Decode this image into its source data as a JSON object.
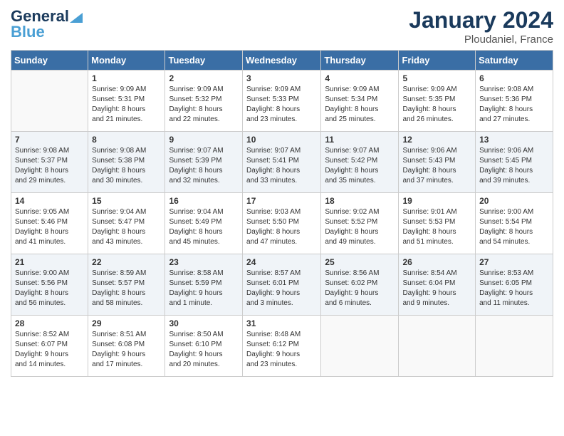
{
  "header": {
    "logo_general": "General",
    "logo_blue": "Blue",
    "month": "January 2024",
    "location": "Ploudaniel, France"
  },
  "days_of_week": [
    "Sunday",
    "Monday",
    "Tuesday",
    "Wednesday",
    "Thursday",
    "Friday",
    "Saturday"
  ],
  "weeks": [
    [
      {
        "day": "",
        "info": ""
      },
      {
        "day": "1",
        "info": "Sunrise: 9:09 AM\nSunset: 5:31 PM\nDaylight: 8 hours\nand 21 minutes."
      },
      {
        "day": "2",
        "info": "Sunrise: 9:09 AM\nSunset: 5:32 PM\nDaylight: 8 hours\nand 22 minutes."
      },
      {
        "day": "3",
        "info": "Sunrise: 9:09 AM\nSunset: 5:33 PM\nDaylight: 8 hours\nand 23 minutes."
      },
      {
        "day": "4",
        "info": "Sunrise: 9:09 AM\nSunset: 5:34 PM\nDaylight: 8 hours\nand 25 minutes."
      },
      {
        "day": "5",
        "info": "Sunrise: 9:09 AM\nSunset: 5:35 PM\nDaylight: 8 hours\nand 26 minutes."
      },
      {
        "day": "6",
        "info": "Sunrise: 9:08 AM\nSunset: 5:36 PM\nDaylight: 8 hours\nand 27 minutes."
      }
    ],
    [
      {
        "day": "7",
        "info": "Sunrise: 9:08 AM\nSunset: 5:37 PM\nDaylight: 8 hours\nand 29 minutes."
      },
      {
        "day": "8",
        "info": "Sunrise: 9:08 AM\nSunset: 5:38 PM\nDaylight: 8 hours\nand 30 minutes."
      },
      {
        "day": "9",
        "info": "Sunrise: 9:07 AM\nSunset: 5:39 PM\nDaylight: 8 hours\nand 32 minutes."
      },
      {
        "day": "10",
        "info": "Sunrise: 9:07 AM\nSunset: 5:41 PM\nDaylight: 8 hours\nand 33 minutes."
      },
      {
        "day": "11",
        "info": "Sunrise: 9:07 AM\nSunset: 5:42 PM\nDaylight: 8 hours\nand 35 minutes."
      },
      {
        "day": "12",
        "info": "Sunrise: 9:06 AM\nSunset: 5:43 PM\nDaylight: 8 hours\nand 37 minutes."
      },
      {
        "day": "13",
        "info": "Sunrise: 9:06 AM\nSunset: 5:45 PM\nDaylight: 8 hours\nand 39 minutes."
      }
    ],
    [
      {
        "day": "14",
        "info": "Sunrise: 9:05 AM\nSunset: 5:46 PM\nDaylight: 8 hours\nand 41 minutes."
      },
      {
        "day": "15",
        "info": "Sunrise: 9:04 AM\nSunset: 5:47 PM\nDaylight: 8 hours\nand 43 minutes."
      },
      {
        "day": "16",
        "info": "Sunrise: 9:04 AM\nSunset: 5:49 PM\nDaylight: 8 hours\nand 45 minutes."
      },
      {
        "day": "17",
        "info": "Sunrise: 9:03 AM\nSunset: 5:50 PM\nDaylight: 8 hours\nand 47 minutes."
      },
      {
        "day": "18",
        "info": "Sunrise: 9:02 AM\nSunset: 5:52 PM\nDaylight: 8 hours\nand 49 minutes."
      },
      {
        "day": "19",
        "info": "Sunrise: 9:01 AM\nSunset: 5:53 PM\nDaylight: 8 hours\nand 51 minutes."
      },
      {
        "day": "20",
        "info": "Sunrise: 9:00 AM\nSunset: 5:54 PM\nDaylight: 8 hours\nand 54 minutes."
      }
    ],
    [
      {
        "day": "21",
        "info": "Sunrise: 9:00 AM\nSunset: 5:56 PM\nDaylight: 8 hours\nand 56 minutes."
      },
      {
        "day": "22",
        "info": "Sunrise: 8:59 AM\nSunset: 5:57 PM\nDaylight: 8 hours\nand 58 minutes."
      },
      {
        "day": "23",
        "info": "Sunrise: 8:58 AM\nSunset: 5:59 PM\nDaylight: 9 hours\nand 1 minute."
      },
      {
        "day": "24",
        "info": "Sunrise: 8:57 AM\nSunset: 6:01 PM\nDaylight: 9 hours\nand 3 minutes."
      },
      {
        "day": "25",
        "info": "Sunrise: 8:56 AM\nSunset: 6:02 PM\nDaylight: 9 hours\nand 6 minutes."
      },
      {
        "day": "26",
        "info": "Sunrise: 8:54 AM\nSunset: 6:04 PM\nDaylight: 9 hours\nand 9 minutes."
      },
      {
        "day": "27",
        "info": "Sunrise: 8:53 AM\nSunset: 6:05 PM\nDaylight: 9 hours\nand 11 minutes."
      }
    ],
    [
      {
        "day": "28",
        "info": "Sunrise: 8:52 AM\nSunset: 6:07 PM\nDaylight: 9 hours\nand 14 minutes."
      },
      {
        "day": "29",
        "info": "Sunrise: 8:51 AM\nSunset: 6:08 PM\nDaylight: 9 hours\nand 17 minutes."
      },
      {
        "day": "30",
        "info": "Sunrise: 8:50 AM\nSunset: 6:10 PM\nDaylight: 9 hours\nand 20 minutes."
      },
      {
        "day": "31",
        "info": "Sunrise: 8:48 AM\nSunset: 6:12 PM\nDaylight: 9 hours\nand 23 minutes."
      },
      {
        "day": "",
        "info": ""
      },
      {
        "day": "",
        "info": ""
      },
      {
        "day": "",
        "info": ""
      }
    ]
  ]
}
